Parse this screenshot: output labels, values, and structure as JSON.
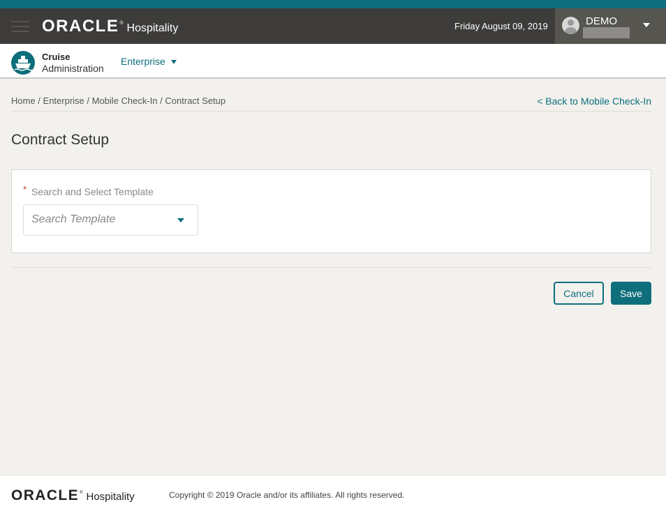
{
  "header": {
    "brand_word": "ORACLE",
    "brand_tm": "®",
    "brand_sub": "Hospitality",
    "date": "Friday August 09, 2019",
    "user_name": "DEMO"
  },
  "subheader": {
    "app_title": "Cruise",
    "app_subtitle": "Administration",
    "enterprise_label": "Enterprise"
  },
  "breadcrumb": {
    "items": [
      "Home",
      "Enterprise",
      "Mobile Check-In",
      "Contract Setup"
    ],
    "separator": " / ",
    "back_link": "< Back to Mobile Check-In"
  },
  "page": {
    "title": "Contract Setup"
  },
  "form": {
    "required_mark": "*",
    "template_label": "Search and Select Template",
    "template_placeholder": "Search Template"
  },
  "actions": {
    "cancel_label": "Cancel",
    "save_label": "Save"
  },
  "footer": {
    "brand_word": "ORACLE",
    "brand_tm": "®",
    "brand_sub": "Hospitality",
    "copyright": "Copyright © 2019 Oracle and/or its affiliates. All rights reserved."
  },
  "colors": {
    "accent": "#0e6e7c",
    "header_bg": "#3d3c3a",
    "page_bg": "#f2f1ee"
  }
}
